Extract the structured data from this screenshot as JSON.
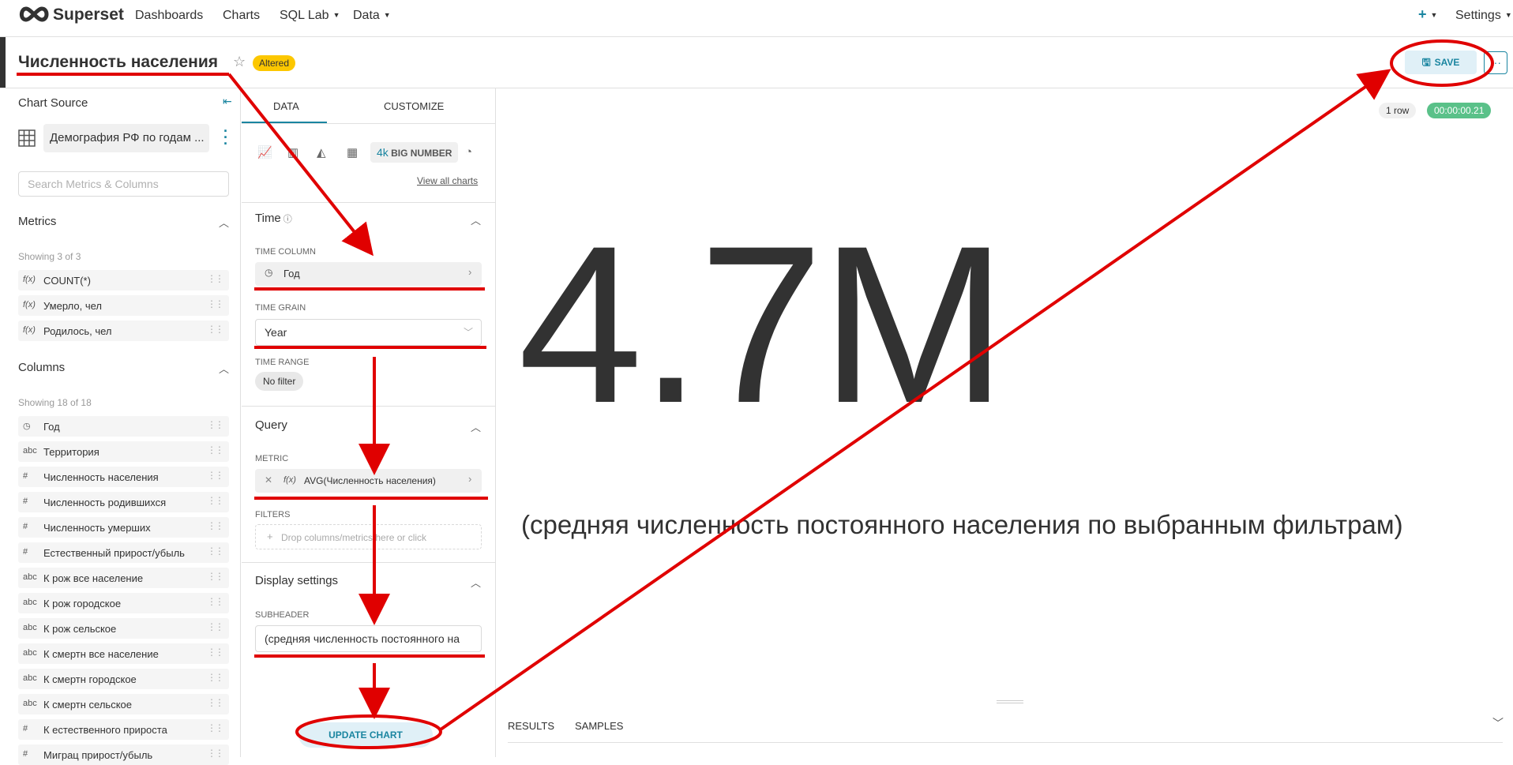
{
  "nav": {
    "brand": "Superset",
    "links": [
      "Dashboards",
      "Charts",
      "SQL Lab",
      "Data"
    ],
    "plus": "+",
    "settings": "Settings"
  },
  "header": {
    "title": "Численность населения",
    "badge": "Altered",
    "save": "SAVE",
    "more": "···"
  },
  "left": {
    "chart_source": "Chart Source",
    "dataset": "Демография РФ по годам ...",
    "search_placeholder": "Search Metrics & Columns",
    "metrics_title": "Metrics",
    "metrics_showing": "Showing 3 of 3",
    "metrics": [
      {
        "icon": "f(x)",
        "label": "COUNT(*)"
      },
      {
        "icon": "f(x)",
        "label": "Умерло, чел"
      },
      {
        "icon": "f(x)",
        "label": "Родилось, чел"
      }
    ],
    "columns_title": "Columns",
    "columns_showing": "Showing 18 of 18",
    "columns": [
      {
        "icon": "clock",
        "label": "Год"
      },
      {
        "icon": "abc",
        "label": "Территория"
      },
      {
        "icon": "#",
        "label": "Численность населения"
      },
      {
        "icon": "#",
        "label": "Численность родившихся"
      },
      {
        "icon": "#",
        "label": "Численность умерших"
      },
      {
        "icon": "#",
        "label": "Естественный прирост/убыль"
      },
      {
        "icon": "abc",
        "label": "К рож все население"
      },
      {
        "icon": "abc",
        "label": "К рож городское"
      },
      {
        "icon": "abc",
        "label": "К рож сельское"
      },
      {
        "icon": "abc",
        "label": "К смертн все население"
      },
      {
        "icon": "abc",
        "label": "К смертн городское"
      },
      {
        "icon": "abc",
        "label": "К смертн сельское"
      },
      {
        "icon": "#",
        "label": "К естественного прироста"
      },
      {
        "icon": "#",
        "label": "Миграц прирост/убыль"
      }
    ]
  },
  "mid": {
    "tab_data": "DATA",
    "tab_customize": "CUSTOMIZE",
    "bignum_k": "4k",
    "bignum_label": "BIG NUMBER",
    "view_all": "View all charts",
    "time_title": "Time",
    "time_column_label": "TIME COLUMN",
    "time_column_value": "Год",
    "time_grain_label": "TIME GRAIN",
    "time_grain_value": "Year",
    "time_range_label": "TIME RANGE",
    "time_range_value": "No filter",
    "query_title": "Query",
    "metric_label": "METRIC",
    "metric_value": "AVG(Численность населения)",
    "filters_label": "FILTERS",
    "filters_placeholder": "Drop columns/metrics here or click",
    "display_title": "Display settings",
    "subheader_label": "SUBHEADER",
    "subheader_value": "(средняя численность постоянного на",
    "update_button": "UPDATE CHART"
  },
  "chart": {
    "rows": "1 row",
    "timer": "00:00:00.21",
    "big_number": "4.7M",
    "subheader": "(средняя численность постоянного населения по выбранным фильтрам)",
    "tab_results": "RESULTS",
    "tab_samples": "SAMPLES"
  },
  "colors": {
    "accent": "#1a85a0",
    "altered": "#fcc700",
    "timer": "#5ac189",
    "annotation": "#e00000"
  }
}
